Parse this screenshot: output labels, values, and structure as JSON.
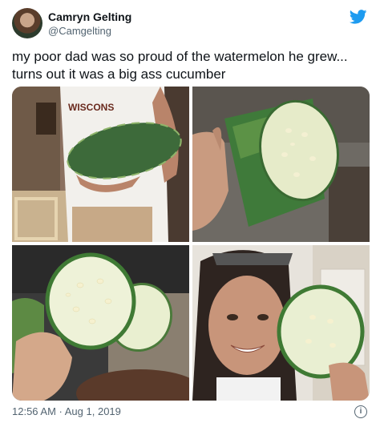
{
  "author": {
    "name": "Camryn Gelting",
    "handle": "@Camgelting"
  },
  "tweet": {
    "text": "my poor dad was so proud of the watermelon he grew... turns out it was a big ass cucumber",
    "timestamp": "12:56 AM · Aug 1, 2019"
  },
  "photos": [
    {
      "label": "man holding large striped fruit"
    },
    {
      "label": "cut end of fruit showing pale flesh"
    },
    {
      "label": "round slice of fruit held up"
    },
    {
      "label": "woman smiling with fruit slice"
    }
  ],
  "icons": {
    "brand": "twitter-bird-icon",
    "info": "info-icon"
  },
  "colors": {
    "twitter_blue": "#1d9bf0",
    "secondary_text": "#536471"
  }
}
